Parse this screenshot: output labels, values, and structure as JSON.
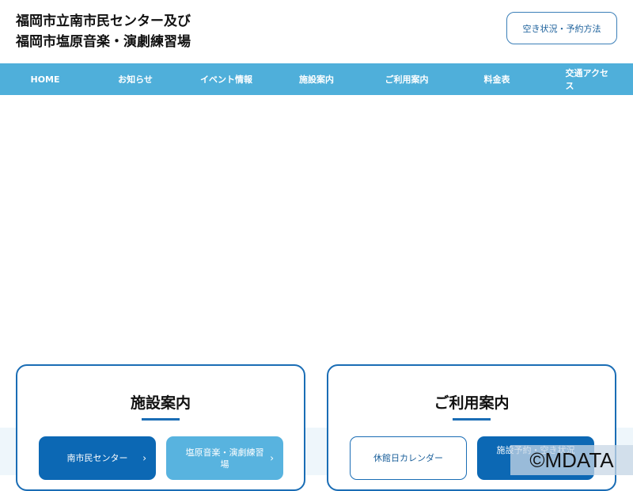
{
  "header": {
    "title_line1": "福岡市立南市民センター及び",
    "title_line2": "福岡市塩原音楽・演劇練習場",
    "reserve_button": "空き状況・予約方法"
  },
  "nav": [
    "HOME",
    "お知らせ",
    "イベント情報",
    "施設案内",
    "ご利用案内",
    "料金表",
    "交通アクセス"
  ],
  "facilities": {
    "heading": "施設案内",
    "buttons": [
      "南市民センター",
      "塩原音楽・演劇練習場"
    ]
  },
  "usage": {
    "heading": "ご利用案内",
    "buttons": [
      "休館日カレンダー",
      "施設予約・空き状況"
    ]
  },
  "watermark": "©MDATA"
}
